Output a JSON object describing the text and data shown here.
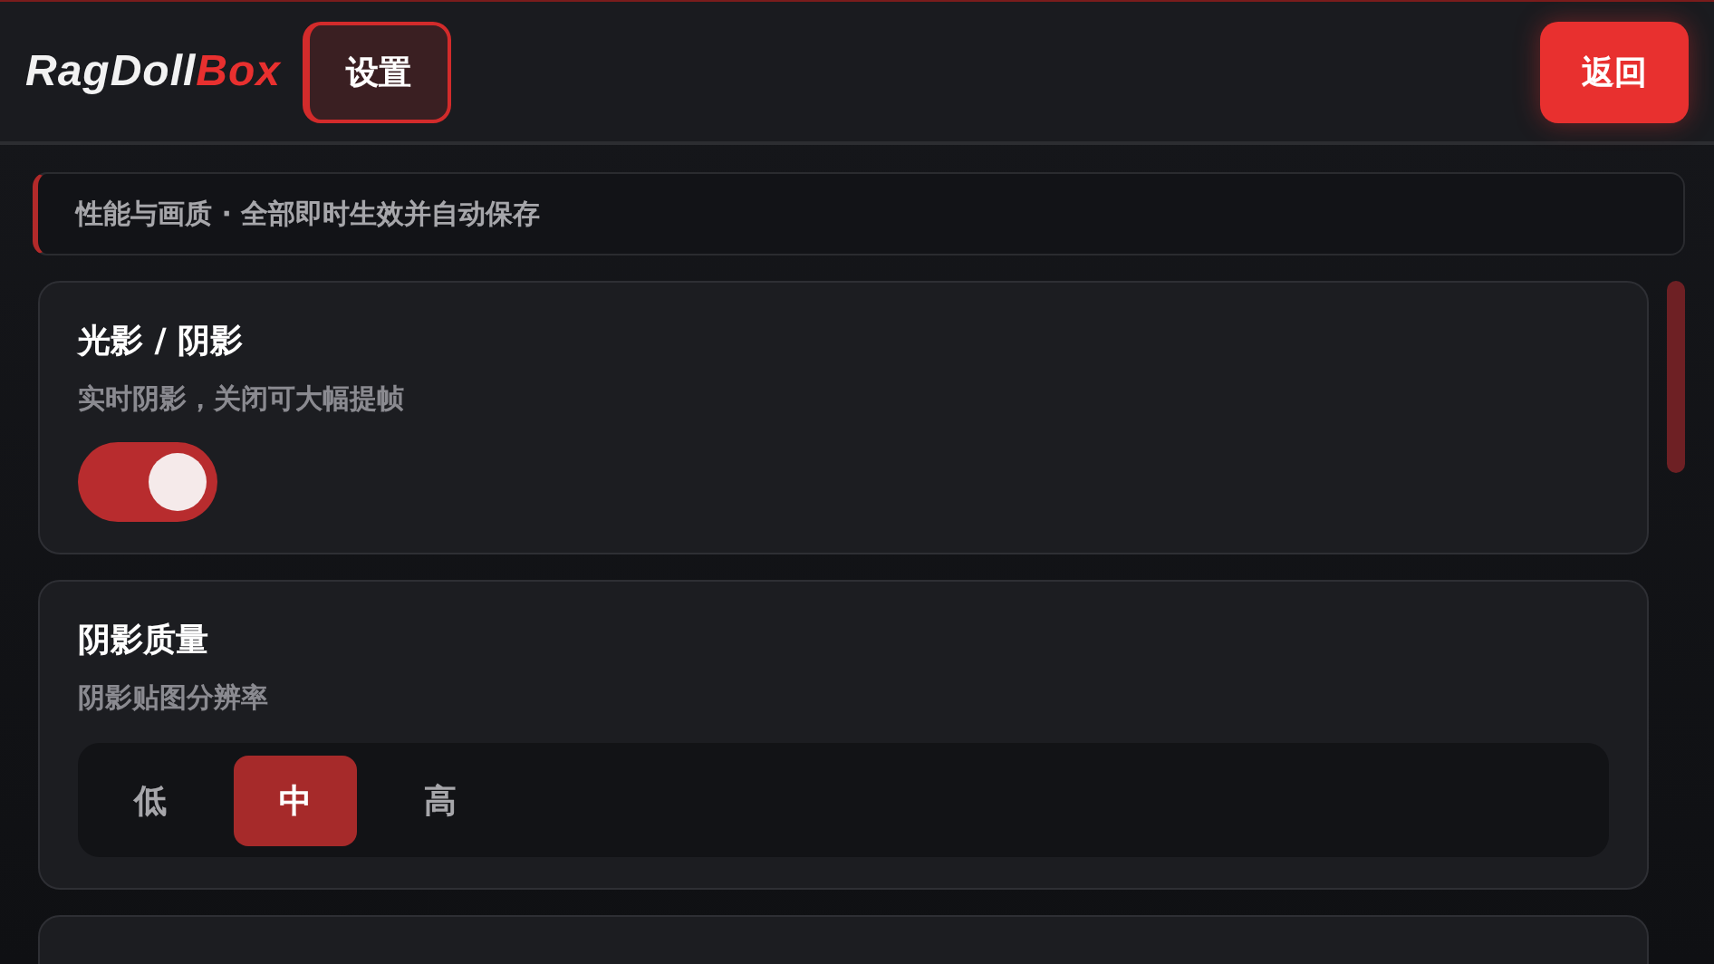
{
  "header": {
    "logo": {
      "text": "RagDoll",
      "accent": "Box"
    },
    "tabs": [
      {
        "label": "设置",
        "selected": true
      }
    ],
    "back_button": "返回"
  },
  "notice": "性能与画质 · 全部即时生效并自动保存",
  "settings": [
    {
      "kind": "toggle",
      "title": "光影 / 阴影",
      "description": "实时阴影，关闭可大幅提帧",
      "on": true
    },
    {
      "kind": "segmented",
      "title": "阴影质量",
      "description": "阴影贴图分辨率",
      "options": [
        {
          "label": "低",
          "selected": false
        },
        {
          "label": "中",
          "selected": true
        },
        {
          "label": "高",
          "selected": false
        }
      ]
    }
  ]
}
